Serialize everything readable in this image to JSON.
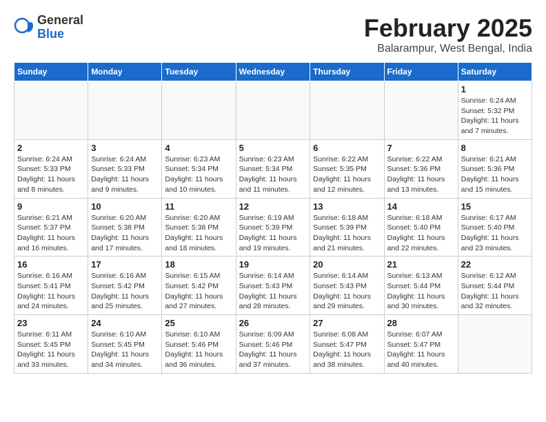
{
  "logo": {
    "general": "General",
    "blue": "Blue"
  },
  "title": {
    "month_year": "February 2025",
    "location": "Balarampur, West Bengal, India"
  },
  "days_of_week": [
    "Sunday",
    "Monday",
    "Tuesday",
    "Wednesday",
    "Thursday",
    "Friday",
    "Saturday"
  ],
  "weeks": [
    [
      {
        "day": "",
        "info": ""
      },
      {
        "day": "",
        "info": ""
      },
      {
        "day": "",
        "info": ""
      },
      {
        "day": "",
        "info": ""
      },
      {
        "day": "",
        "info": ""
      },
      {
        "day": "",
        "info": ""
      },
      {
        "day": "1",
        "info": "Sunrise: 6:24 AM\nSunset: 5:32 PM\nDaylight: 11 hours and 7 minutes."
      }
    ],
    [
      {
        "day": "2",
        "info": "Sunrise: 6:24 AM\nSunset: 5:33 PM\nDaylight: 11 hours and 8 minutes."
      },
      {
        "day": "3",
        "info": "Sunrise: 6:24 AM\nSunset: 5:33 PM\nDaylight: 11 hours and 9 minutes."
      },
      {
        "day": "4",
        "info": "Sunrise: 6:23 AM\nSunset: 5:34 PM\nDaylight: 11 hours and 10 minutes."
      },
      {
        "day": "5",
        "info": "Sunrise: 6:23 AM\nSunset: 5:34 PM\nDaylight: 11 hours and 11 minutes."
      },
      {
        "day": "6",
        "info": "Sunrise: 6:22 AM\nSunset: 5:35 PM\nDaylight: 11 hours and 12 minutes."
      },
      {
        "day": "7",
        "info": "Sunrise: 6:22 AM\nSunset: 5:36 PM\nDaylight: 11 hours and 13 minutes."
      },
      {
        "day": "8",
        "info": "Sunrise: 6:21 AM\nSunset: 5:36 PM\nDaylight: 11 hours and 15 minutes."
      }
    ],
    [
      {
        "day": "9",
        "info": "Sunrise: 6:21 AM\nSunset: 5:37 PM\nDaylight: 11 hours and 16 minutes."
      },
      {
        "day": "10",
        "info": "Sunrise: 6:20 AM\nSunset: 5:38 PM\nDaylight: 11 hours and 17 minutes."
      },
      {
        "day": "11",
        "info": "Sunrise: 6:20 AM\nSunset: 5:38 PM\nDaylight: 11 hours and 18 minutes."
      },
      {
        "day": "12",
        "info": "Sunrise: 6:19 AM\nSunset: 5:39 PM\nDaylight: 11 hours and 19 minutes."
      },
      {
        "day": "13",
        "info": "Sunrise: 6:18 AM\nSunset: 5:39 PM\nDaylight: 11 hours and 21 minutes."
      },
      {
        "day": "14",
        "info": "Sunrise: 6:18 AM\nSunset: 5:40 PM\nDaylight: 11 hours and 22 minutes."
      },
      {
        "day": "15",
        "info": "Sunrise: 6:17 AM\nSunset: 5:40 PM\nDaylight: 11 hours and 23 minutes."
      }
    ],
    [
      {
        "day": "16",
        "info": "Sunrise: 6:16 AM\nSunset: 5:41 PM\nDaylight: 11 hours and 24 minutes."
      },
      {
        "day": "17",
        "info": "Sunrise: 6:16 AM\nSunset: 5:42 PM\nDaylight: 11 hours and 25 minutes."
      },
      {
        "day": "18",
        "info": "Sunrise: 6:15 AM\nSunset: 5:42 PM\nDaylight: 11 hours and 27 minutes."
      },
      {
        "day": "19",
        "info": "Sunrise: 6:14 AM\nSunset: 5:43 PM\nDaylight: 11 hours and 28 minutes."
      },
      {
        "day": "20",
        "info": "Sunrise: 6:14 AM\nSunset: 5:43 PM\nDaylight: 11 hours and 29 minutes."
      },
      {
        "day": "21",
        "info": "Sunrise: 6:13 AM\nSunset: 5:44 PM\nDaylight: 11 hours and 30 minutes."
      },
      {
        "day": "22",
        "info": "Sunrise: 6:12 AM\nSunset: 5:44 PM\nDaylight: 11 hours and 32 minutes."
      }
    ],
    [
      {
        "day": "23",
        "info": "Sunrise: 6:11 AM\nSunset: 5:45 PM\nDaylight: 11 hours and 33 minutes."
      },
      {
        "day": "24",
        "info": "Sunrise: 6:10 AM\nSunset: 5:45 PM\nDaylight: 11 hours and 34 minutes."
      },
      {
        "day": "25",
        "info": "Sunrise: 6:10 AM\nSunset: 5:46 PM\nDaylight: 11 hours and 36 minutes."
      },
      {
        "day": "26",
        "info": "Sunrise: 6:09 AM\nSunset: 5:46 PM\nDaylight: 11 hours and 37 minutes."
      },
      {
        "day": "27",
        "info": "Sunrise: 6:08 AM\nSunset: 5:47 PM\nDaylight: 11 hours and 38 minutes."
      },
      {
        "day": "28",
        "info": "Sunrise: 6:07 AM\nSunset: 5:47 PM\nDaylight: 11 hours and 40 minutes."
      },
      {
        "day": "",
        "info": ""
      }
    ]
  ]
}
